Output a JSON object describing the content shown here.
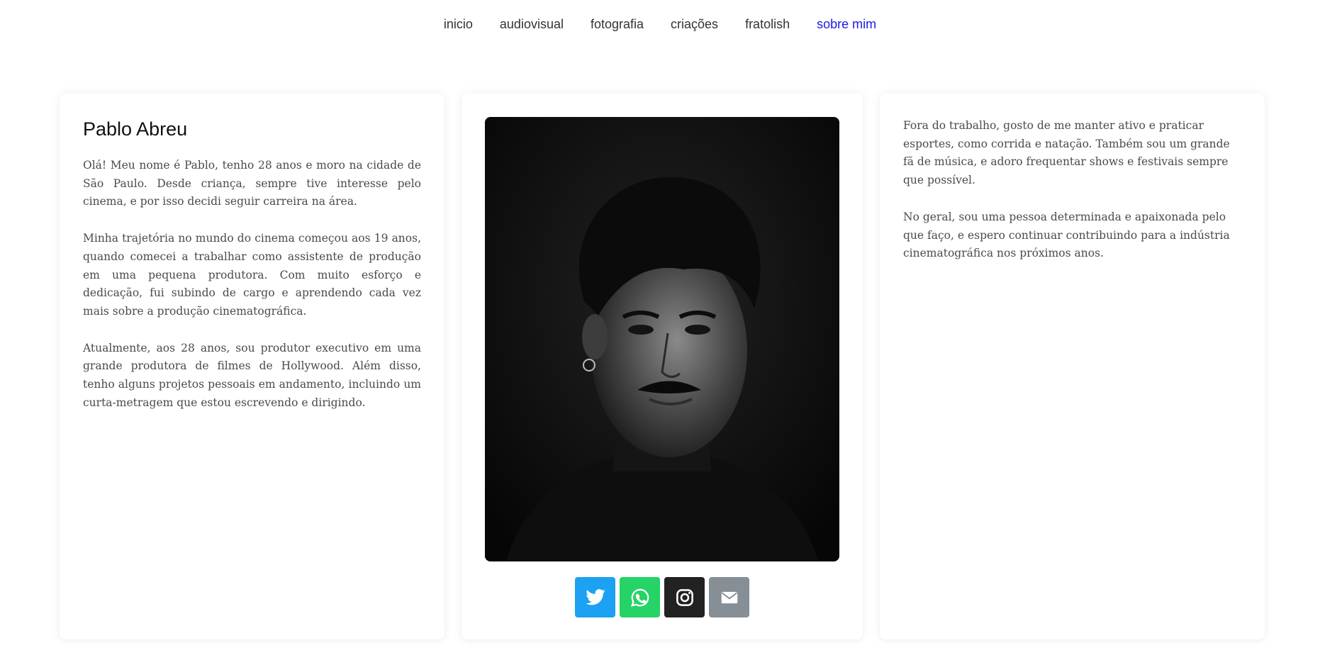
{
  "nav": {
    "items": [
      {
        "label": "inicio",
        "active": false
      },
      {
        "label": "audiovisual",
        "active": false
      },
      {
        "label": "fotografia",
        "active": false
      },
      {
        "label": "criações",
        "active": false
      },
      {
        "label": "fratolish",
        "active": false
      },
      {
        "label": "sobre mim",
        "active": true
      }
    ],
    "active_color": "#1a1ae6"
  },
  "profile": {
    "name": "Pablo Abreu",
    "left_paragraphs": [
      "Olá! Meu nome é Pablo, tenho 28 anos e moro na cidade de São Paulo. Desde criança, sempre tive interesse pelo cinema, e por isso decidi seguir carreira na área.",
      "Minha trajetória no mundo do cinema começou aos 19 anos, quando comecei a trabalhar como assistente de produção em uma pequena produtora. Com muito esforço e dedicação, fui subindo de cargo e aprendendo cada vez mais sobre a produção cinematográfica.",
      "Atualmente, aos 28 anos, sou produtor executivo em uma grande produtora de filmes de Hollywood. Além disso, tenho alguns projetos pessoais em andamento, incluindo um curta-metragem que estou escrevendo e dirigindo."
    ],
    "right_paragraphs": [
      "Fora do trabalho, gosto de me manter ativo e praticar esportes, como corrida e natação. Também sou um grande fã de música, e adoro frequentar shows e festivais sempre que possível.",
      "No geral, sou uma pessoa determinada e apaixonada pelo que faço, e espero continuar contribuindo para a indústria cinematográfica nos próximos anos."
    ]
  },
  "socials": [
    {
      "icon": "twitter-icon",
      "color": "#1da1f2"
    },
    {
      "icon": "whatsapp-icon",
      "color": "#25d366"
    },
    {
      "icon": "instagram-icon",
      "color": "#222222"
    },
    {
      "icon": "email-icon",
      "color": "#868e96"
    }
  ]
}
